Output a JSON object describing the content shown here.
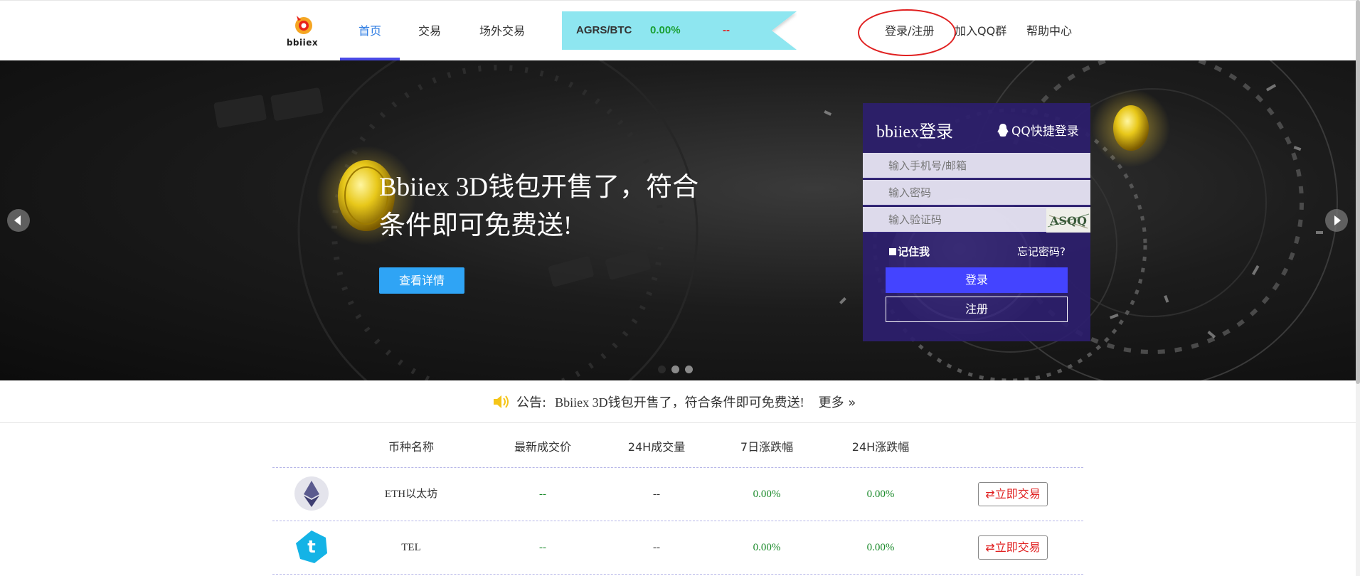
{
  "header": {
    "logo_text": "bbiiex",
    "nav": [
      {
        "label": "首页",
        "active": true
      },
      {
        "label": "交易",
        "active": false
      },
      {
        "label": "场外交易",
        "active": false
      }
    ],
    "ticker": {
      "pair": "AGRS/BTC",
      "change": "0.00%",
      "price": "--"
    },
    "login_register": "登录/注册",
    "join_qq": "加入QQ群",
    "help": "帮助中心"
  },
  "banner": {
    "title": "Bbiiex 3D钱包开售了，符合条件即可免费送!",
    "button": "查看详情",
    "slides": 3,
    "active_slide": 0
  },
  "login": {
    "title": "bbiiex登录",
    "qq_login": "QQ快捷登录",
    "phone_placeholder": "输入手机号/邮箱",
    "password_placeholder": "输入密码",
    "captcha_placeholder": "输入验证码",
    "captcha_text": "ASQQ",
    "remember": "记住我",
    "forgot": "忘记密码?",
    "login_button": "登录",
    "register_button": "注册"
  },
  "notice": {
    "label": "公告:",
    "text": "Bbiiex 3D钱包开售了，符合条件即可免费送!",
    "more": "更多 »"
  },
  "market": {
    "headers": [
      "币种名称",
      "最新成交价",
      "24H成交量",
      "7日涨跌幅",
      "24H涨跌幅"
    ],
    "trade_label": "⇄立即交易",
    "rows": [
      {
        "name": "ETH以太坊",
        "icon": "ethereum-icon",
        "price": "--",
        "volume": "--",
        "change_7d": "0.00%",
        "change_24h": "0.00%"
      },
      {
        "name": "TEL",
        "icon": "telcoin-icon",
        "price": "--",
        "volume": "--",
        "change_7d": "0.00%",
        "change_24h": "0.00%"
      }
    ]
  },
  "colors": {
    "accent": "#4444ff",
    "nav_active": "#2a7ae2",
    "ticker_bg": "#8ee6f0",
    "positive": "#1a8a2a",
    "negative": "#e02020",
    "login_panel": "#2d1e6e",
    "banner_button": "#2fa4f5"
  }
}
